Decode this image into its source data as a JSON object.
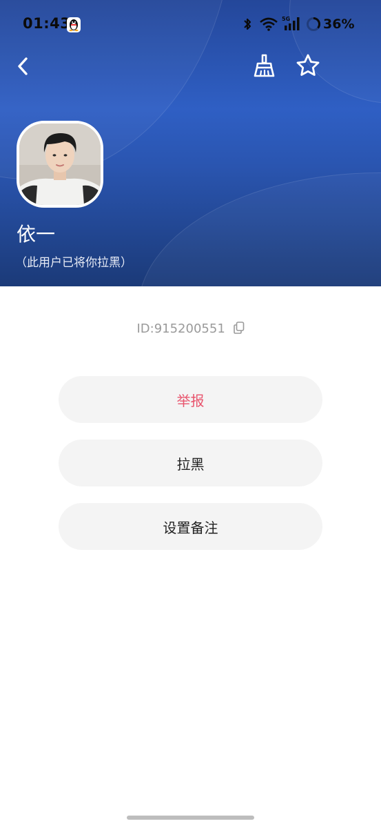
{
  "status_bar": {
    "time": "01:43",
    "battery_percent": "36%",
    "network_label": "5G",
    "icons": [
      "qq-penguin-icon",
      "bluetooth-icon",
      "wifi-icon",
      "signal-icon",
      "battery-ring-icon"
    ]
  },
  "header": {
    "back_icon": "chevron-left-icon",
    "clear_icon": "broom-icon",
    "favorite_icon": "star-icon"
  },
  "profile": {
    "name": "依一",
    "status_note": "（此用户已将你拉黑）",
    "id_text": "ID:915200551",
    "copy_icon": "copy-icon"
  },
  "actions": {
    "report_label": "举报",
    "block_label": "拉黑",
    "remark_label": "设置备注"
  },
  "colors": {
    "header_blue": "#2f5fc4",
    "report_red": "#e8546d",
    "button_bg": "#f4f4f4"
  }
}
